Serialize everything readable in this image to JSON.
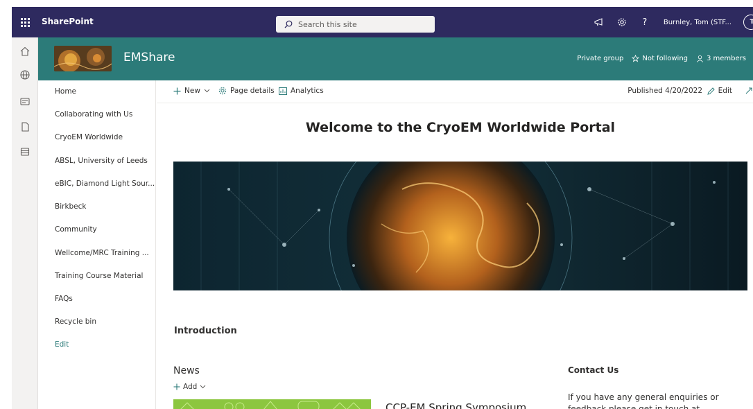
{
  "suite": {
    "app_name": "SharePoint",
    "search_placeholder": "Search this site",
    "user_name": "Burnley, Tom (STF...",
    "user_initials": "TI"
  },
  "site": {
    "title": "EMShare",
    "privacy": "Private group",
    "follow": "Not following",
    "members": "3 members"
  },
  "nav": {
    "items": [
      "Home",
      "Collaborating with Us",
      "CryoEM Worldwide",
      "ABSL, University of Leeds",
      "eBIC, Diamond Light Sour...",
      "Birkbeck",
      "Community",
      "Wellcome/MRC Training ...",
      "Training Course Material",
      "FAQs",
      "Recycle bin"
    ],
    "edit": "Edit"
  },
  "commandbar": {
    "new": "New",
    "page_details": "Page details",
    "analytics": "Analytics",
    "published": "Published 4/20/2022",
    "edit": "Edit"
  },
  "page": {
    "title": "Welcome to the CryoEM Worldwide Portal",
    "intro_heading": "Introduction",
    "news_heading": "News",
    "add_label": "Add",
    "news_item_title": "CCP-EM Spring Symposium",
    "contact_heading": "Contact Us",
    "contact_text": "If you have any general enquiries or feedback please get in touch at"
  },
  "colors": {
    "suitebar": "#2e2a5f",
    "site_header": "#2c7b79",
    "accent": "#2c7b79"
  }
}
